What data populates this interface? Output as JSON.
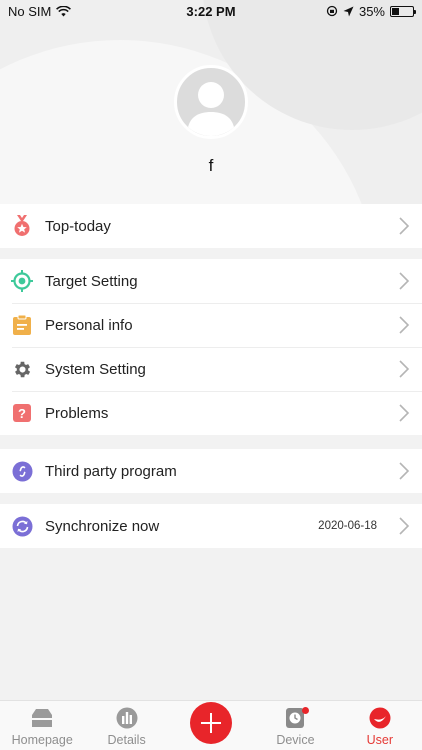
{
  "status_bar": {
    "carrier": "No SIM",
    "time": "3:22 PM",
    "battery": "35%"
  },
  "profile": {
    "username": "f"
  },
  "menu_groups": [
    [
      {
        "label": "Top-today",
        "icon": "medal-icon"
      }
    ],
    [
      {
        "label": "Target Setting",
        "icon": "target-icon"
      },
      {
        "label": "Personal info",
        "icon": "clipboard-icon"
      },
      {
        "label": "System Setting",
        "icon": "gear-icon"
      },
      {
        "label": "Problems",
        "icon": "question-icon"
      }
    ],
    [
      {
        "label": "Third party program",
        "icon": "link-icon"
      }
    ],
    [
      {
        "label": "Synchronize now",
        "icon": "sync-icon",
        "value": "2020-06-18"
      }
    ]
  ],
  "tabs": [
    {
      "label": "Homepage",
      "icon": "home-icon"
    },
    {
      "label": "Details",
      "icon": "bar-chart-icon"
    },
    {
      "label": "",
      "icon": "plus-icon"
    },
    {
      "label": "Device",
      "icon": "watch-icon"
    },
    {
      "label": "User",
      "icon": "user-icon",
      "active": true
    }
  ],
  "colors": {
    "accent": "#e8252a",
    "medal": "#f07070",
    "target": "#3ec99a",
    "clipboard": "#f0b04a",
    "gear": "#666666",
    "question": "#f07070",
    "link": "#7b6fd6",
    "sync": "#7b6fd6"
  }
}
